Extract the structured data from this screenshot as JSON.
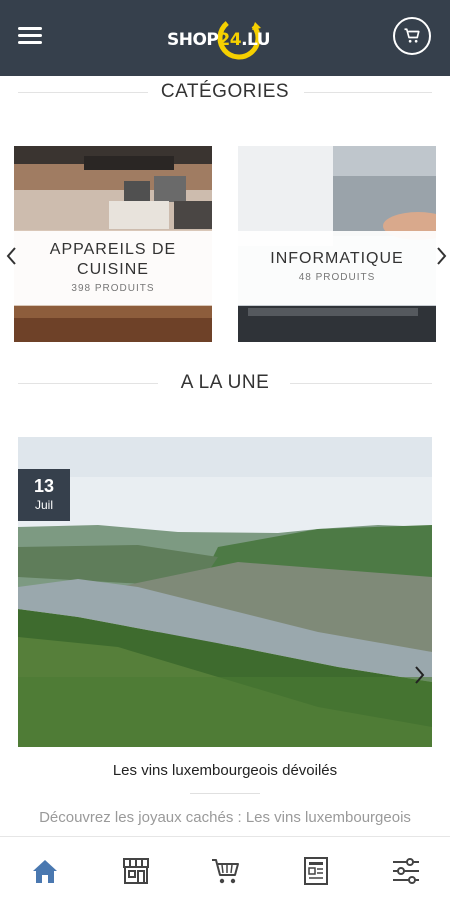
{
  "header": {
    "logo_main": "SHOP",
    "logo_number": "24",
    "logo_suffix": ".LU",
    "menu_icon": "hamburger-menu-icon",
    "cart_icon": "cart-icon"
  },
  "sections": {
    "categories_title": "CATÉGORIES",
    "featured_title": "A LA UNE"
  },
  "categories": [
    {
      "name_line1": "APPAREILS DE",
      "name_line2": "CUISINE",
      "count": "398 PRODUITS"
    },
    {
      "name_line1": "",
      "name_line2": "INFORMATIQUE",
      "count": "48 PRODUITS"
    }
  ],
  "featured": {
    "date_day": "13",
    "date_month": "Juil",
    "title": "Les vins luxembourgeois dévoilés",
    "excerpt": "Découvrez les joyaux cachés : Les vins luxembourgeois dévoilés et révélés aux amateurs"
  },
  "bottom_nav": [
    {
      "icon": "home-icon",
      "active": true
    },
    {
      "icon": "store-icon",
      "active": false
    },
    {
      "icon": "shopping-cart-icon",
      "active": false
    },
    {
      "icon": "news-icon",
      "active": false
    },
    {
      "icon": "settings-sliders-icon",
      "active": false
    }
  ],
  "colors": {
    "header_bg": "#36404c",
    "accent_yellow": "#f5d000",
    "active_nav": "#4a78b0"
  }
}
